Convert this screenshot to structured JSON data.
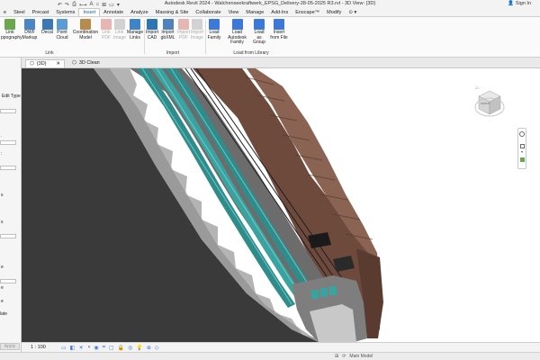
{
  "window": {
    "title": "Autodesk Revit 2024 - Walchenseekraftwerk_EPSG_Delivery-28-05-2025 R3.rvt - 3D View: {3D}",
    "sign_in": "Sign In"
  },
  "menu": {
    "tabs": [
      "e",
      "Steel",
      "Precast",
      "Systems",
      "Insert",
      "Annotate",
      "Analyze",
      "Massing & Site",
      "Collaborate",
      "View",
      "Manage",
      "Add-Ins",
      "Enscape™",
      "Modify",
      "⊙ ▾"
    ],
    "active": "Insert"
  },
  "ribbon": {
    "buttons": {
      "link_topography": [
        "Link",
        "ppography"
      ],
      "dwf_markup": [
        "DWF",
        "Markup"
      ],
      "decal": [
        "Decal",
        ""
      ],
      "point_cloud": [
        "Point",
        "Cloud"
      ],
      "coordination_model": [
        "Coordination",
        "Model"
      ],
      "link_pdf": [
        "Link",
        "PDF"
      ],
      "link_image": [
        "Link",
        "Image"
      ],
      "manage_links": [
        "Manage",
        "Links"
      ],
      "import_cad": [
        "Import",
        "CAD"
      ],
      "import_gbxml": [
        "Import",
        "gbXML"
      ],
      "import_pdf": [
        "Import",
        "PDF"
      ],
      "import_image": [
        "Import",
        "Image"
      ],
      "load_family": [
        "Load",
        "Family"
      ],
      "load_autodesk_family": [
        "Load Autodesk",
        "Family"
      ],
      "load_as_group": [
        "Load as",
        "Group"
      ],
      "insert_from_file": [
        "Insert",
        "from File"
      ]
    },
    "groups": {
      "link": "Link",
      "import": "Import",
      "load_from_library": "Load from Library"
    }
  },
  "properties_panel": {
    "edit_type": "Edit Type",
    "apply": "Apply",
    "fragments": [
      ".",
      ":",
      "s",
      "s",
      "e",
      "e",
      "e",
      "late"
    ]
  },
  "doc_tabs": [
    {
      "label": "{3D}",
      "active": true
    },
    {
      "label": "3D Clean",
      "active": false
    }
  ],
  "viewcube": {
    "face_label": "FRONT",
    "icons": [
      "home-icon"
    ]
  },
  "status": {
    "scale": "1 : 100",
    "workset": "Main Model"
  },
  "colors": {
    "terrain": "#6e4a3c",
    "terrain_dark": "#4d342b",
    "concrete_dark": "#3a3a3a",
    "concrete": "#8a8a8a",
    "pipe_teal": "#2f8c8a",
    "pipe_teal_light": "#5cc4c0",
    "accent": "#0b5cad"
  }
}
